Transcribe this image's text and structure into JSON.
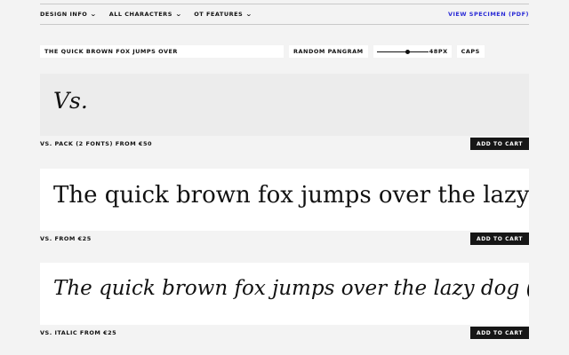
{
  "nav": {
    "design_info": "DESIGN INFO",
    "all_characters": "ALL CHARACTERS",
    "ot_features": "OT FEATURES",
    "view_specimen": "VIEW SPECIMEN (PDF)"
  },
  "controls": {
    "text_value": "THE QUICK BROWN FOX JUMPS OVER",
    "random_pangram": "RANDOM PANGRAM",
    "size_value": "48PX",
    "size_fraction": 0.6,
    "caps": "CAPS"
  },
  "products": [
    {
      "sample": "Vs.",
      "price": "VS. PACK (2 FONTS) FROM €50",
      "button": "ADD TO CART"
    },
    {
      "sample": "The quick brown fox jumps over the lazy dog (en)",
      "price": "VS. FROM €25",
      "button": "ADD TO CART"
    },
    {
      "sample": "The quick brown fox jumps over the lazy dog (en)",
      "price": "VS. ITALIC FROM €25",
      "button": "ADD TO CART"
    }
  ],
  "colors": {
    "accent_link": "#2a2bd6",
    "button_bg": "#161616",
    "page_bg": "#f3f3f3"
  }
}
